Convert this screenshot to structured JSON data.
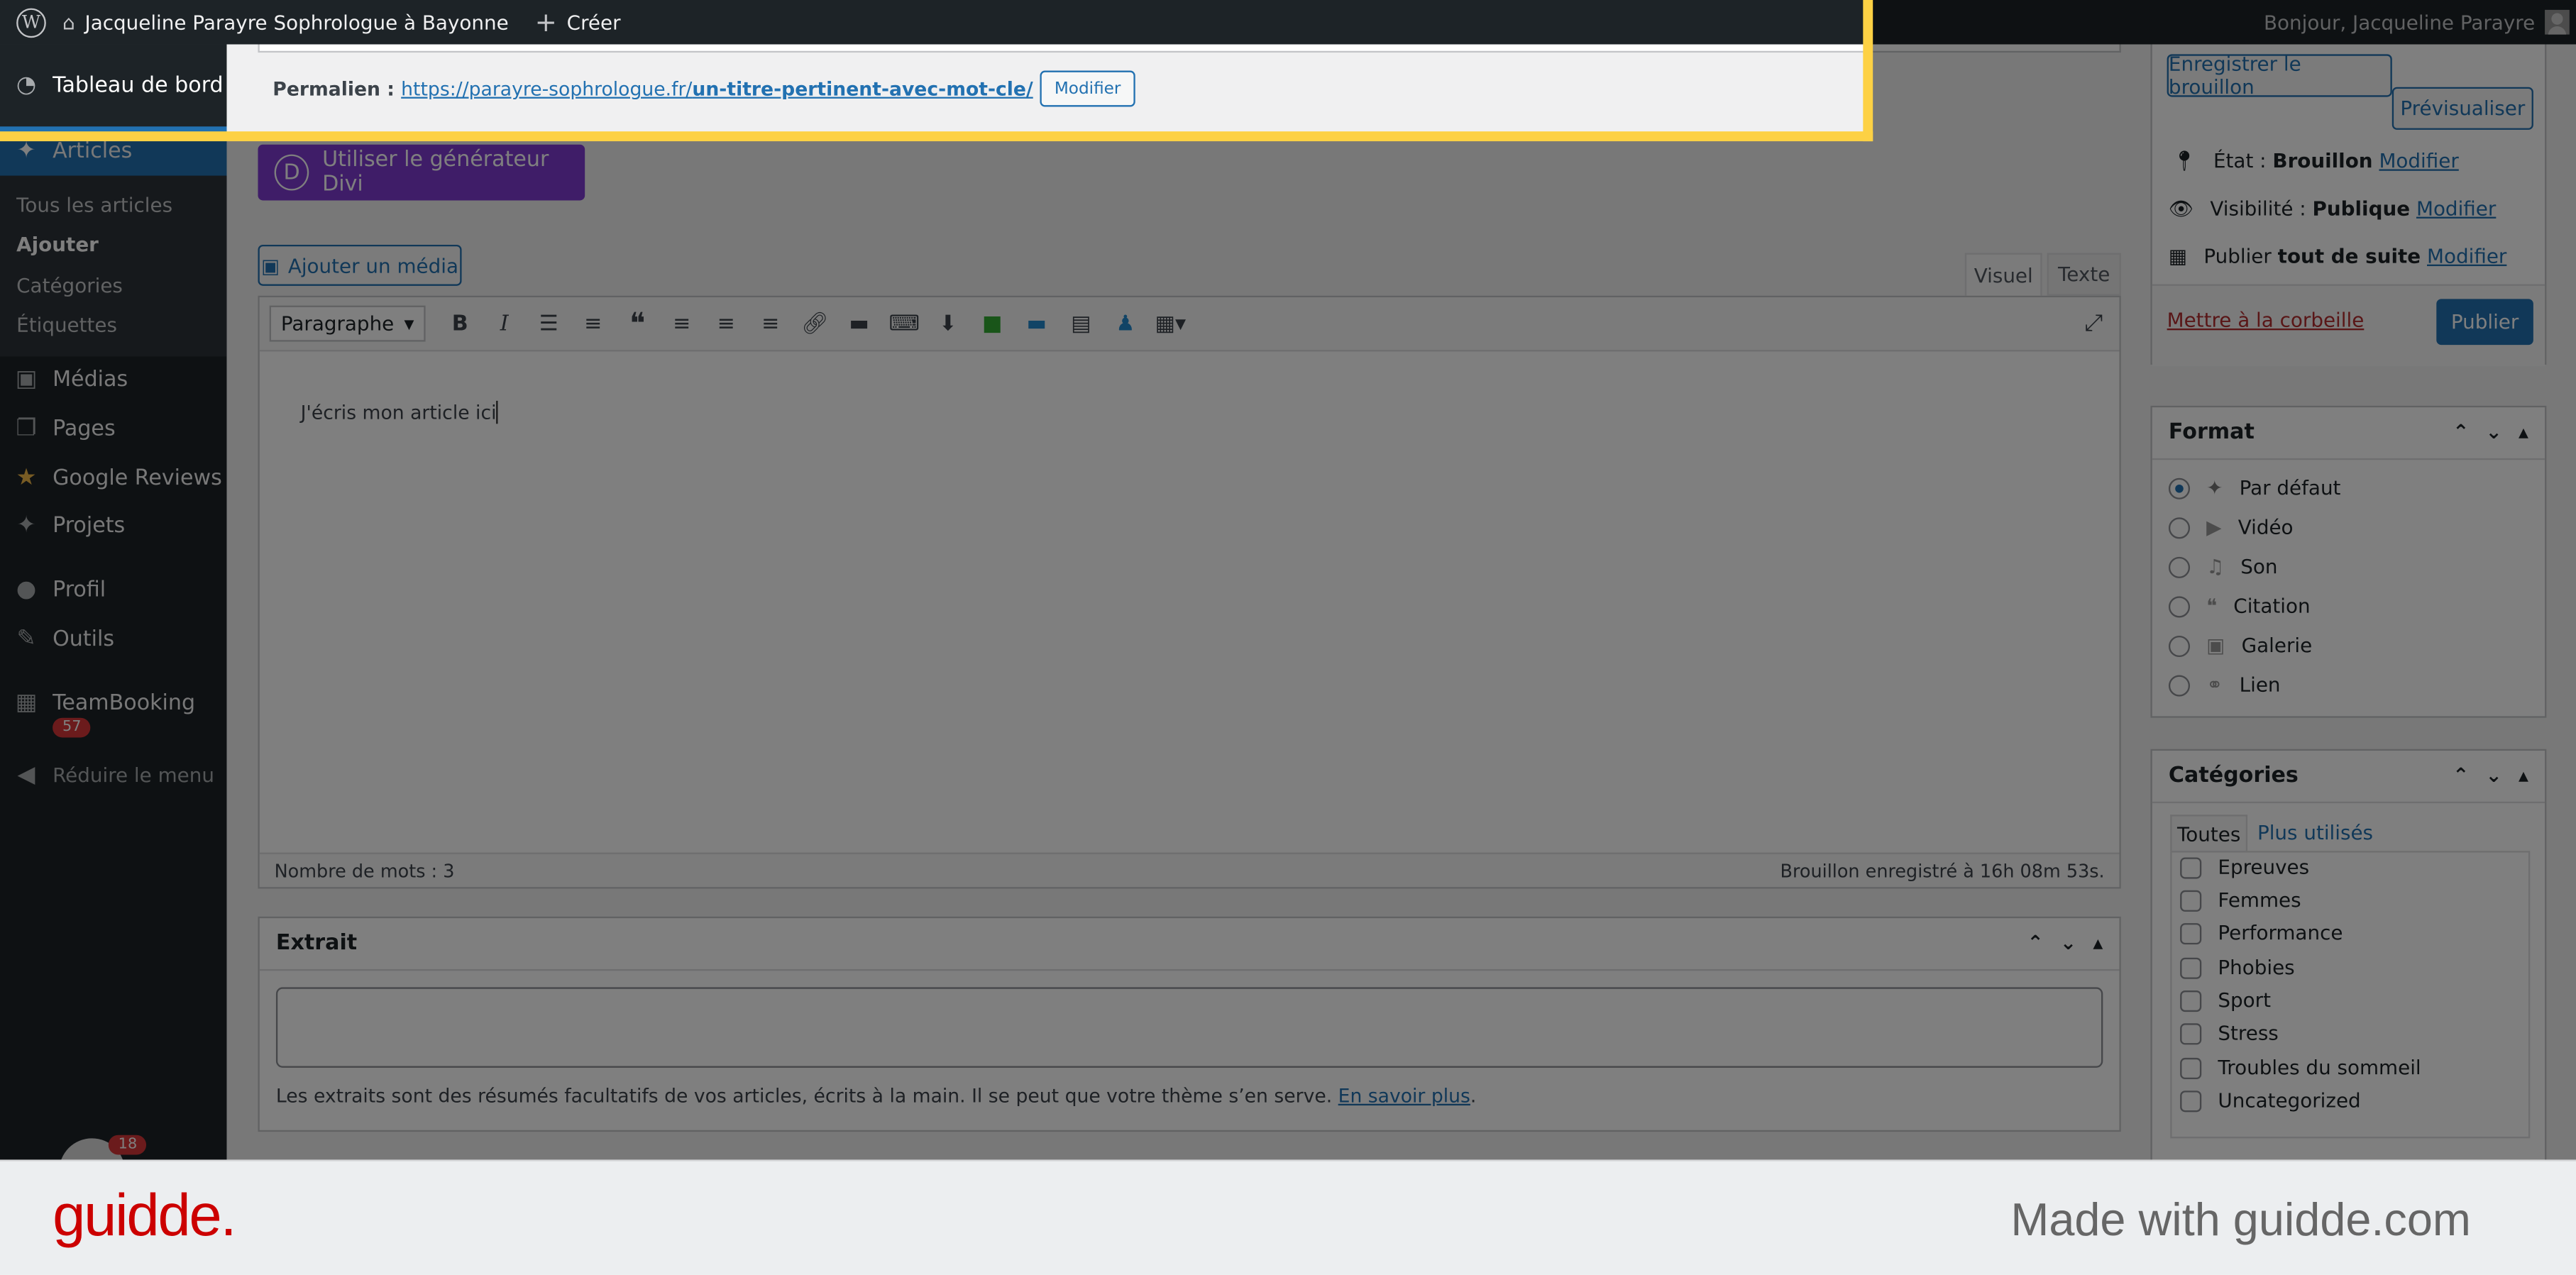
{
  "adminbar": {
    "site": "Jacqueline Parayre Sophrologue à Bayonne",
    "create": "Créer",
    "greeting": "Bonjour, Jacqueline Parayre"
  },
  "sidebar": {
    "dashboard": "Tableau de bord",
    "articles": "Articles",
    "sub": [
      "Tous les articles",
      "Ajouter",
      "Catégories",
      "Étiquettes"
    ],
    "medias": "Médias",
    "pages": "Pages",
    "google_reviews": "Google Reviews",
    "projets": "Projets",
    "profil": "Profil",
    "outils": "Outils",
    "teambooking": "TeamBooking",
    "teambooking_badge": "57",
    "collapse": "Réduire le menu",
    "bottom_badge": "18"
  },
  "permalink": {
    "label": "Permalien :",
    "url_base": "https://parayre-sophrologue.fr/",
    "url_slug": "un-titre-pertinent-avec-mot-cle/",
    "edit": "Modifier"
  },
  "divi_button": "Utiliser le générateur Divi",
  "divi_letter": "D",
  "editor": {
    "add_media": "Ajouter un média",
    "tab_visual": "Visuel",
    "tab_text": "Texte",
    "format_select": "Paragraphe",
    "content": "J'écris mon article ici",
    "word_count": "Nombre de mots : 3",
    "draft_saved": "Brouillon enregistré à 16h 08m 53s."
  },
  "excerpt": {
    "title": "Extrait",
    "help": "Les extraits sont des résumés facultatifs de vos articles, écrits à la main. Il se peut que votre thème s’en serve.",
    "learn_more": "En savoir plus",
    "period": "."
  },
  "publish": {
    "save_draft": "Enregistrer le brouillon",
    "preview": "Prévisualiser",
    "status_label": "État :",
    "status_value": "Brouillon",
    "visibility_label": "Visibilité :",
    "visibility_value": "Publique",
    "publish_label": "Publier",
    "publish_value": "tout de suite",
    "edit": "Modifier",
    "trash": "Mettre à la corbeille",
    "publish_button": "Publier"
  },
  "format": {
    "title": "Format",
    "options": [
      "Par défaut",
      "Vidéo",
      "Son",
      "Citation",
      "Galerie",
      "Lien"
    ],
    "selected": "Par défaut"
  },
  "categories": {
    "title": "Catégories",
    "tab_all": "Toutes",
    "tab_popular": "Plus utilisés",
    "items": [
      "Epreuves",
      "Femmes",
      "Performance",
      "Phobies",
      "Sport",
      "Stress",
      "Troubles du sommeil",
      "Uncategorized"
    ]
  },
  "footer": {
    "logo": "guidde.",
    "made_with": "Made with guidde.com"
  },
  "colors": {
    "highlight": "#fdd144",
    "accent": "#2271b1",
    "divi": "#7e3bd0",
    "guidde_red": "#cc0000"
  }
}
